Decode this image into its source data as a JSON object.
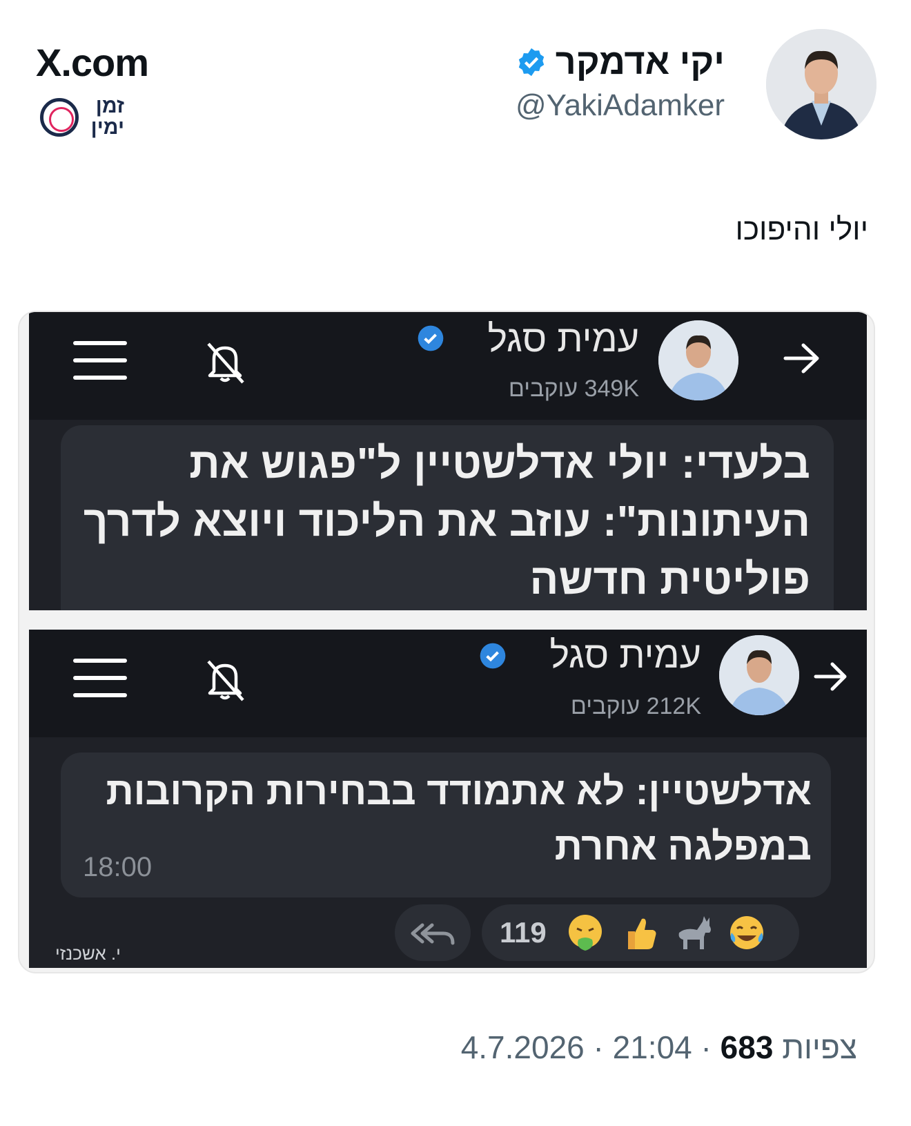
{
  "site_label": "X.com",
  "logo": {
    "line1": "זמן",
    "line2": "ימין"
  },
  "author": {
    "name": "יקי אדמקר",
    "handle": "@YakiAdamker"
  },
  "tweet_text": "יולי והיפוכו",
  "screens": [
    {
      "channel_name": "עמית סגל",
      "followers": "349K עוקבים",
      "message_lines": [
        "בלעדי: יולי אדלשטיין ל\"פגוש את",
        "העיתונות\": עוזב את הליכוד ויוצא לדרך",
        "פוליטית חדשה"
      ]
    },
    {
      "channel_name": "עמית סגל",
      "followers": "212K עוקבים",
      "message_lines": [
        "אדלשטיין: לא אתמודד בבחירות הקרובות",
        "במפלגה אחרת"
      ],
      "time": "18:00",
      "reaction_count": "119",
      "reactions": [
        "joy-emoji",
        "donkey-emoji",
        "thumbs-up-emoji",
        "nauseated-emoji"
      ],
      "credit": "י. אשכנזי"
    }
  ],
  "footer": {
    "date": "4.7.2026",
    "time": "21:04",
    "views": "683",
    "views_label": "צפיות"
  },
  "colors": {
    "verified_blue": "#1d9bf0",
    "dark_bg": "#1f2127",
    "bar_bg": "#15171c"
  }
}
